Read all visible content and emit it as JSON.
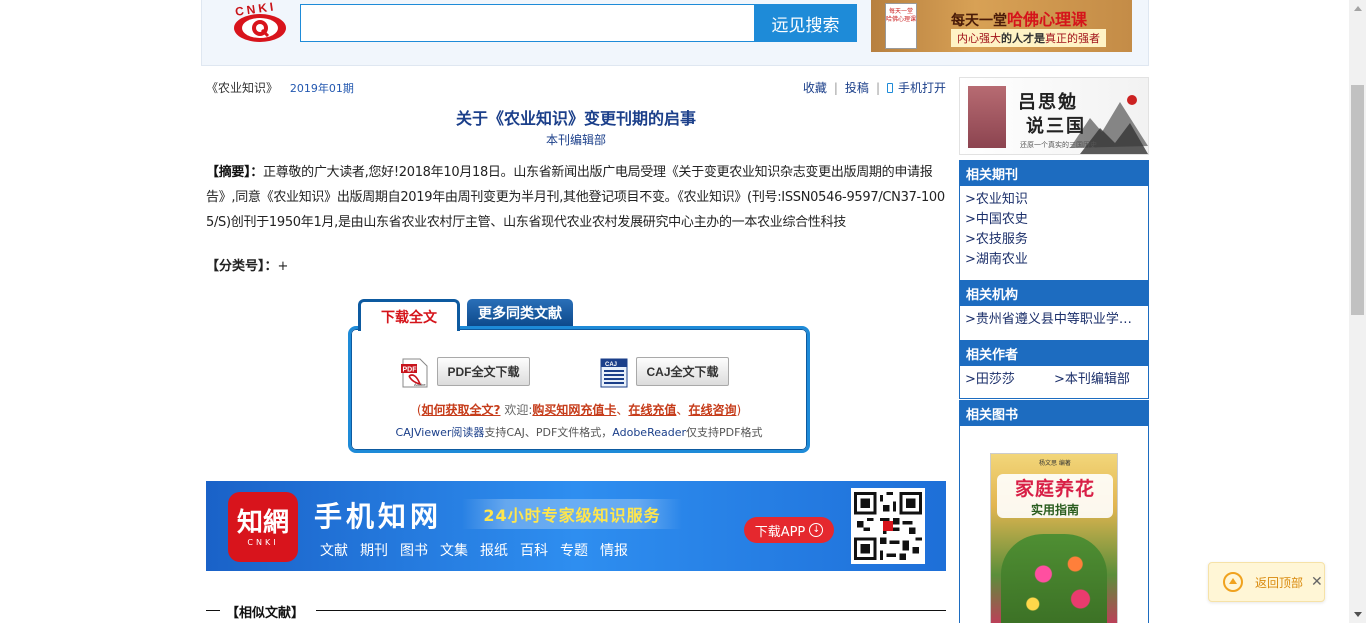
{
  "header": {
    "logo_text": "CNKI",
    "search_value": "",
    "search_button": "远见搜索",
    "ad_book_text": "每天一堂 哈佛心理课",
    "ad_title_prefix": "每天一堂",
    "ad_title_highlight": "哈佛心理课",
    "ad_sub_1": "内心强大",
    "ad_sub_2": "的人才是",
    "ad_sub_3": "真正的强者"
  },
  "breadcrumb": {
    "journal": "《农业知识》",
    "issue": "2019年01期"
  },
  "tools": {
    "favorite": "收藏",
    "submit": "投稿",
    "mobile": "手机打开"
  },
  "article": {
    "title": "关于《农业知识》变更刊期的启事",
    "author": "本刊编辑部",
    "abstract_label": "【摘要】：",
    "abstract_text": "正尊敬的广大读者,您好!2018年10月18日。山东省新闻出版广电局受理《关于变更农业知识杂志变更出版周期的申请报告》,同意《农业知识》出版周期自2019年由周刊变更为半月刊,其他登记项目不变。《农业知识》(刊号:ISSN0546-9597/CN37-1005/S)创刊于1950年1月,是由山东省农业农村厅主管、山东省现代农业农村发展研究中心主办的一本农业综合性科技",
    "class_label": "【分类号】：",
    "class_value": "+"
  },
  "download": {
    "tab_active": "下载全文",
    "tab_other": "更多同类文献",
    "pdf_button": "PDF全文下载",
    "caj_button": "CAJ全文下载",
    "pdf_icon_text": "Adobe",
    "caj_icon_text": "CAJ",
    "paren_open": "(",
    "how_link": "如何获取全文?",
    "welcome": "欢迎:",
    "buy_link": "购买知网充值卡",
    "sep": "、",
    "recharge_link": "在线充值",
    "consult_link": "在线咨询",
    "paren_close": ")",
    "note_caj": "CAJViewer阅读器",
    "note_mid": "支持CAJ、PDF文件格式，",
    "note_adobe": "AdobeReader",
    "note_end": "仅支持PDF格式"
  },
  "mobile_banner": {
    "logo_big": "知網",
    "logo_small": "CNKI",
    "title": "手机知网",
    "service": "24小时专家级知识服务",
    "categories": [
      "文献",
      "期刊",
      "图书",
      "文集",
      "报纸",
      "百科",
      "专题",
      "情报"
    ],
    "app_button": "下载APP",
    "app_arrow": "↓"
  },
  "similar": {
    "label": "【相似文献】"
  },
  "sidebar": {
    "ad_title_1": "吕思勉",
    "ad_title_2": "说三国",
    "ad_sub": "还原一个真实的三国历史",
    "sections": [
      {
        "title": "相关期刊",
        "items": [
          ">农业知识",
          ">中国农史",
          ">农技服务",
          ">湖南农业"
        ]
      },
      {
        "title": "相关机构",
        "items": [
          ">贵州省遵义县中等职业学校..."
        ]
      },
      {
        "title": "相关作者",
        "items": [
          ">田莎莎",
          ">本刊编辑部"
        ]
      },
      {
        "title": "相关图书",
        "items": []
      }
    ],
    "book_tag": "杨文思 编著",
    "book_title_1": "家庭养花",
    "book_title_2": "实用指南"
  },
  "back_top": {
    "label": "返回顶部",
    "close": "✕"
  },
  "colors": {
    "accent_blue": "#1e8bd8",
    "nav_blue": "#1d6cc0",
    "link_navy": "#1b3f8a",
    "alert_red": "#d5141b"
  }
}
